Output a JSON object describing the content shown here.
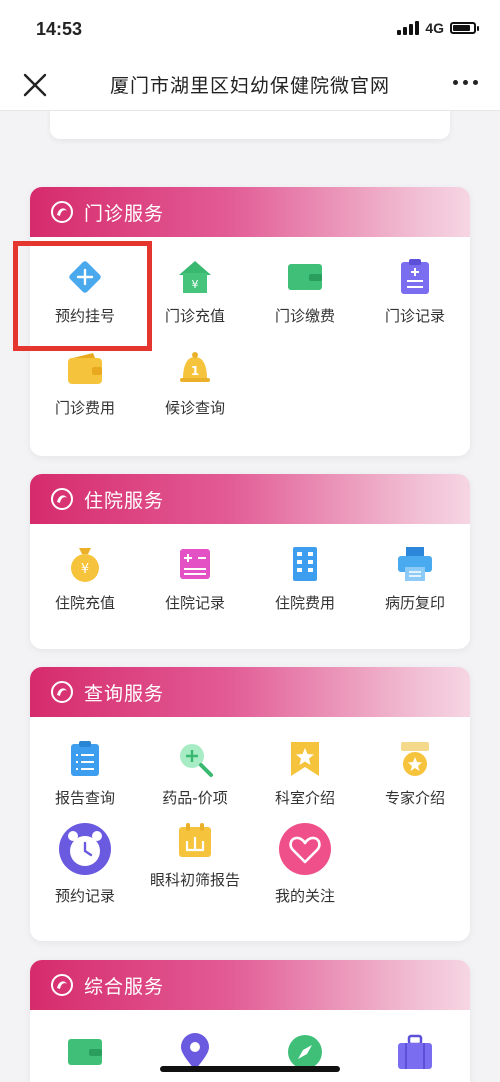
{
  "status": {
    "time": "14:53",
    "network": "4G"
  },
  "nav": {
    "title": "厦门市湖里区妇幼保健院微官网"
  },
  "sections": [
    {
      "title": "门诊服务",
      "items": [
        {
          "label": "预约挂号",
          "icon": "plus-diamond-icon"
        },
        {
          "label": "门诊充值",
          "icon": "yuan-house-icon"
        },
        {
          "label": "门诊缴费",
          "icon": "wallet-icon"
        },
        {
          "label": "门诊记录",
          "icon": "clipboard-icon"
        },
        {
          "label": "门诊费用",
          "icon": "purse-icon"
        },
        {
          "label": "候诊查询",
          "icon": "bell-icon",
          "badge": "1"
        }
      ]
    },
    {
      "title": "住院服务",
      "items": [
        {
          "label": "住院充值",
          "icon": "yuan-bag-icon"
        },
        {
          "label": "住院记录",
          "icon": "calculator-icon"
        },
        {
          "label": "住院费用",
          "icon": "building-icon"
        },
        {
          "label": "病历复印",
          "icon": "printer-icon"
        }
      ]
    },
    {
      "title": "查询服务",
      "items": [
        {
          "label": "报告查询",
          "icon": "report-icon"
        },
        {
          "label": "药品-价项",
          "icon": "magnifier-icon"
        },
        {
          "label": "科室介绍",
          "icon": "bookmark-star-icon"
        },
        {
          "label": "专家介绍",
          "icon": "medal-icon"
        },
        {
          "label": "预约记录",
          "icon": "alarm-clock-icon"
        },
        {
          "label": "眼科初筛报告",
          "icon": "calendar-icon"
        },
        {
          "label": "我的关注",
          "icon": "heart-icon"
        }
      ]
    },
    {
      "title": "综合服务",
      "items": [
        {
          "label": "",
          "icon": "wallet-icon"
        },
        {
          "label": "",
          "icon": "location-pin-icon"
        },
        {
          "label": "",
          "icon": "compass-icon"
        },
        {
          "label": "",
          "icon": "suitcase-icon"
        }
      ]
    }
  ],
  "colors": {
    "accent": "#d62b6c",
    "highlight": "#e5352f"
  }
}
